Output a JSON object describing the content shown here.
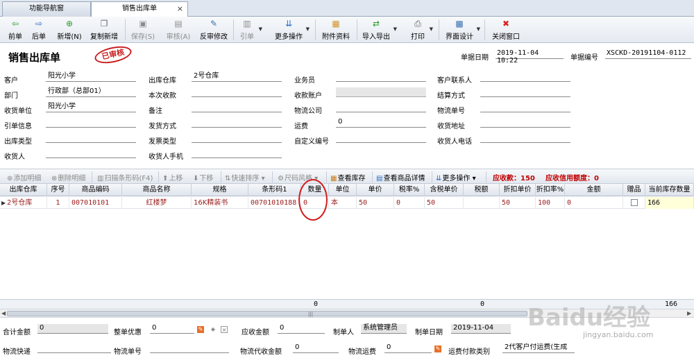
{
  "tabs": [
    {
      "label": "功能导航窗"
    },
    {
      "label": "销售出库单"
    }
  ],
  "toolbar": [
    {
      "label": "前单",
      "icon": "arrow-left-icon"
    },
    {
      "label": "后单",
      "icon": "arrow-right-icon"
    },
    {
      "label": "新增(N)",
      "icon": "add-icon"
    },
    {
      "label": "复制新增",
      "icon": "copy-icon"
    },
    {
      "label": "保存(S)",
      "icon": "save-icon"
    },
    {
      "label": "审核(A)",
      "icon": "audit-icon"
    },
    {
      "label": "反审修改",
      "icon": "unaudit-icon"
    },
    {
      "label": "引单",
      "icon": "import-doc-icon"
    },
    {
      "label": "更多操作",
      "icon": "more-icon"
    },
    {
      "label": "附件资料",
      "icon": "attachment-icon"
    },
    {
      "label": "导入导出",
      "icon": "import-export-icon"
    },
    {
      "label": "打印",
      "icon": "print-icon"
    },
    {
      "label": "界面设计",
      "icon": "layout-icon"
    },
    {
      "label": "关闭窗口",
      "icon": "close-window-icon"
    }
  ],
  "doc": {
    "title": "销售出库单",
    "stamp": "已审核",
    "date_label": "单据日期",
    "date_value": "2019-11-04 10:22",
    "no_label": "单据编号",
    "no_value": "XSCKD-20191104-0112"
  },
  "form": {
    "customer_label": "客户",
    "customer": "阳光小学",
    "dept_label": "部门",
    "dept": "行政部（总部01）",
    "recv_unit_label": "收货单位",
    "recv_unit": "阳光小学",
    "ref_info_label": "引单信息",
    "ref_info": "",
    "out_type_label": "出库类型",
    "out_type": "",
    "receiver_label": "收货人",
    "receiver": "",
    "warehouse_label": "出库仓库",
    "warehouse": "2号仓库",
    "this_recv_label": "本次收款",
    "this_recv": "",
    "remark_label": "备注",
    "remark": "",
    "ship_method_label": "发货方式",
    "ship_method": "",
    "invoice_type_label": "发票类型",
    "invoice_type": "",
    "receiver_phone_label": "收货人手机",
    "receiver_phone": "",
    "salesman_label": "业务员",
    "salesman": "",
    "recv_account_label": "收款账户",
    "recv_account": "",
    "logistics_label": "物流公司",
    "logistics": "",
    "freight_label": "运费",
    "freight": "0",
    "custom_no_label": "自定义编号",
    "custom_no": "",
    "contact_label": "客户联系人",
    "contact": "",
    "settle_label": "结算方式",
    "settle": "",
    "logistics_no_label": "物流单号",
    "logistics_no": "",
    "recv_addr_label": "收货地址",
    "recv_addr": "",
    "recv_phone_label": "收货人电话",
    "recv_phone": ""
  },
  "grid_toolbar": {
    "add_detail": "添加明细",
    "del_detail": "删除明细",
    "scan": "扫描条形码(F4)",
    "up": "上移",
    "down": "下移",
    "sort": "快速排序",
    "size": "尺码风格",
    "view_stock": "查看库存",
    "view_detail": "查看商品详情",
    "more": "更多操作",
    "receivable": "应收款：150",
    "credit": "应收信用额度：0"
  },
  "table": {
    "headers": [
      "出库仓库",
      "序号",
      "商品编码",
      "商品名称",
      "规格",
      "条形码1",
      "数量",
      "单位",
      "单价",
      "税率%",
      "含税单价",
      "税额",
      "折扣单价",
      "折扣率%",
      "金额",
      "赠品",
      "当前库存数量"
    ],
    "row": [
      "2号仓库",
      "1",
      "007010101",
      "红楼梦",
      "16K精装书",
      "00701010188",
      "0",
      "本",
      "50",
      "0",
      "50",
      "",
      "50",
      "100",
      "0",
      "",
      "166"
    ],
    "totals": {
      "qty": "0",
      "amount": "0",
      "stock": "166"
    }
  },
  "bottom": {
    "total_label": "合计金额",
    "total": "0",
    "discount_label": "整单优惠",
    "discount": "0",
    "receivable_label": "应收金额",
    "receivable": "0",
    "maker_label": "制单人",
    "maker": "系统管理员",
    "make_date_label": "制单日期",
    "make_date": "2019-11-04",
    "express_label": "物流快递",
    "express": "",
    "express_no_label": "物流单号",
    "express_no": "",
    "cod_label": "物流代收金额",
    "cod": "0",
    "freight_label": "物流运费",
    "freight": "0",
    "pay_type_label": "运费付款类别",
    "pay_type": "2代客户付运费(生成"
  },
  "watermark": {
    "logo": "Baidu经验",
    "url": "jingyan.baidu.com"
  }
}
